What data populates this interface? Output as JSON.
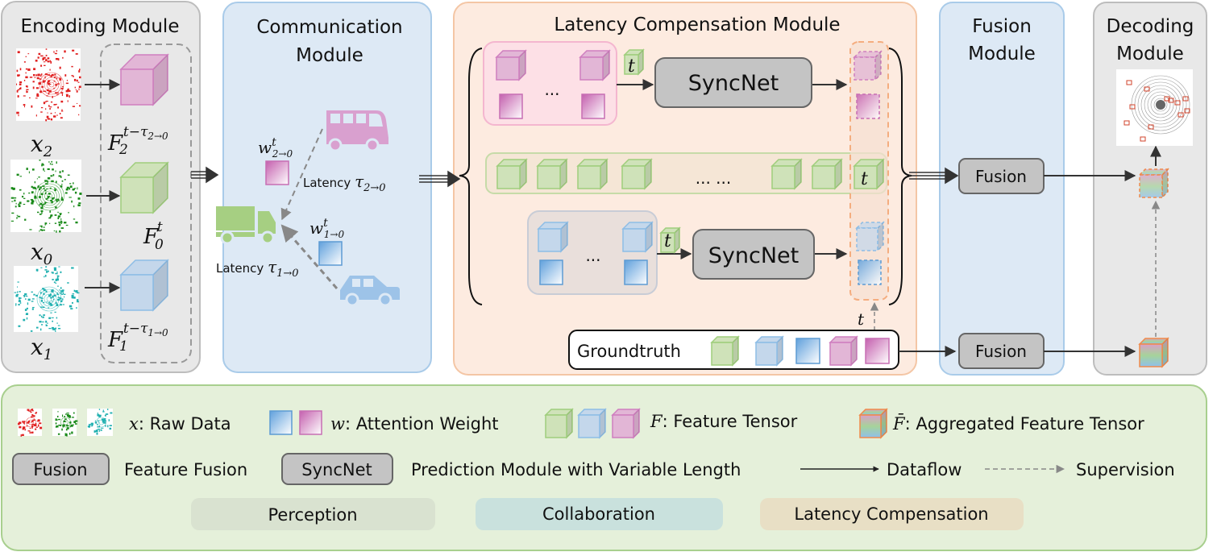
{
  "panels": {
    "encoding": "Encoding Module",
    "communication": [
      "Communication",
      "Module"
    ],
    "latency": "Latency Compensation Module",
    "fusion": [
      "Fusion",
      "Module"
    ],
    "decoding": [
      "Decoding",
      "Module"
    ]
  },
  "encoding": {
    "x2": {
      "base": "x",
      "sub": "2"
    },
    "x0": {
      "base": "x",
      "sub": "0"
    },
    "x1": {
      "base": "x",
      "sub": "1"
    },
    "F2": {
      "base": "F",
      "sub": "2",
      "sup": "t−τ",
      "supsub": "2→0"
    },
    "F0": {
      "base": "F",
      "sub": "0",
      "sup": "t"
    },
    "F1": {
      "base": "F",
      "sub": "1",
      "sup": "t−τ",
      "supsub": "1→0"
    }
  },
  "communication": {
    "w2": {
      "base": "w",
      "sup": "t",
      "sub": "2→0"
    },
    "w1": {
      "base": "w",
      "sup": "t",
      "sub": "1→0"
    },
    "latency2": {
      "text": "Latency ",
      "sym": "τ",
      "sub": "2→0"
    },
    "latency1": {
      "text": "Latency ",
      "sym": "τ",
      "sub": "1→0"
    }
  },
  "latency_module": {
    "syncnet": "SyncNet",
    "ellipsis": "...",
    "long_ellipsis": "... ...",
    "t": "t",
    "groundtruth": "Groundtruth"
  },
  "fusion": {
    "label": "Fusion"
  },
  "legend": {
    "raw_data": {
      "sym": "x",
      "text": ": Raw Data"
    },
    "attention": {
      "sym": "w",
      "text": ": Attention Weight"
    },
    "feature": {
      "sym": "F",
      "text": ": Feature Tensor"
    },
    "aggregated": {
      "sym": "F̄",
      "text": ": Aggregated Feature Tensor"
    },
    "fusion_box": "Fusion",
    "fusion_text": "Feature Fusion",
    "syncnet_box": "SyncNet",
    "syncnet_text": "Prediction Module with Variable Length",
    "dataflow": "Dataflow",
    "supervision": "Supervision",
    "pills": [
      "Perception",
      "Collaboration",
      "Latency Compensation"
    ]
  },
  "colors": {
    "pink": "#e2b6d6",
    "pink_stroke": "#cf7fbf",
    "green": "#cfe2b9",
    "green_stroke": "#9fce7c",
    "blue": "#c4d7eb",
    "blue_stroke": "#8dbde6",
    "encoding_bg": "#e8e8e8",
    "communication_bg": "#dde9f5",
    "latency_bg": "#fdebe0",
    "legend_bg": "#e5f0da",
    "perception_pill": "#d9e2d0",
    "collaboration_pill": "#c9e1dd",
    "latency_pill": "#e8dfc5"
  }
}
